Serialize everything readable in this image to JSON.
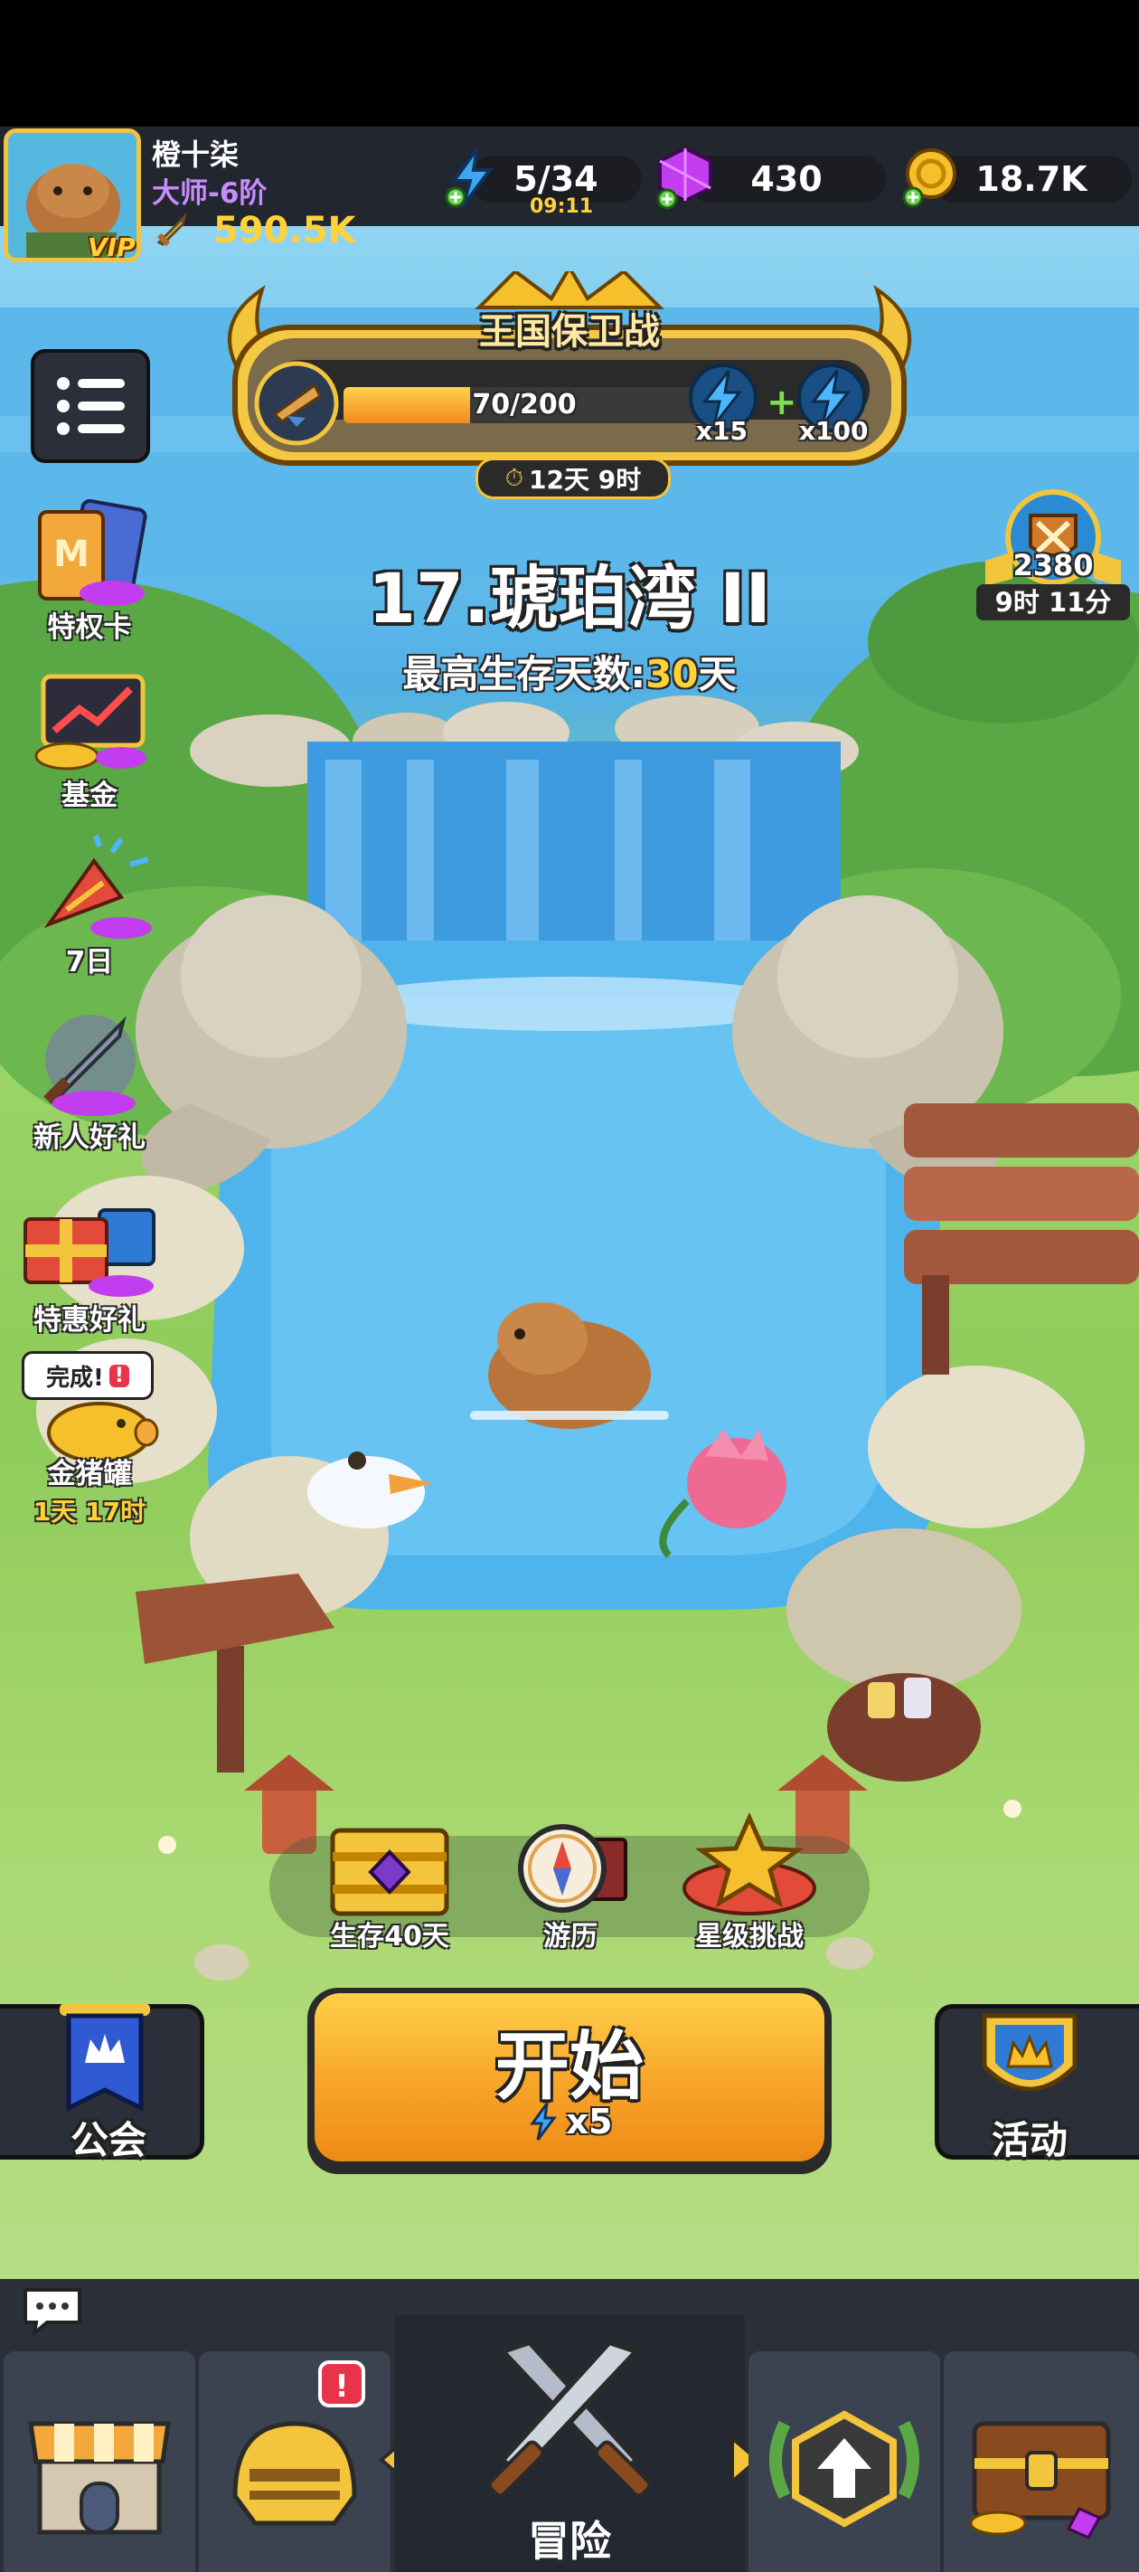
{
  "player": {
    "name": "橙十柒",
    "rank": "大师-6阶",
    "power": "590.5K",
    "vip_label": "VIP"
  },
  "resources": {
    "energy": "5/34",
    "energy_timer": "09:11",
    "gems": "430",
    "gold": "18.7K"
  },
  "event": {
    "title": "王国保卫战",
    "progress_text": "70/200",
    "progress_fraction": 0.35,
    "reward_1": "x15",
    "reward_2": "x100",
    "timer": "12天 9时"
  },
  "arena_badge": {
    "score": "2380",
    "timer": "9时 11分"
  },
  "stage": {
    "title": "17.琥珀湾 II",
    "best_prefix": "最高生存天数:",
    "best_value": "30",
    "best_suffix": "天"
  },
  "sidebar": {
    "items": [
      {
        "label": "特权卡"
      },
      {
        "label": "基金"
      },
      {
        "label": "7日"
      },
      {
        "label": "新人好礼"
      },
      {
        "label": "特惠好礼"
      },
      {
        "label": "金猪罐",
        "badge": "完成!",
        "timer": "1天 17时"
      }
    ]
  },
  "quick_actions": [
    {
      "label": "生存40天"
    },
    {
      "label": "游历"
    },
    {
      "label": "星级挑战"
    }
  ],
  "start_button": {
    "label": "开始",
    "cost": "x5"
  },
  "guild_button": {
    "label": "公会"
  },
  "activity_button": {
    "label": "活动"
  },
  "nav": {
    "center_label": "冒险",
    "badge": "!"
  },
  "colors": {
    "accent_orange": "#f7a428",
    "gold_text": "#ffd23a",
    "topbar": "#22262f",
    "water": "#52b0e6",
    "grass": "#8ecb5a"
  }
}
